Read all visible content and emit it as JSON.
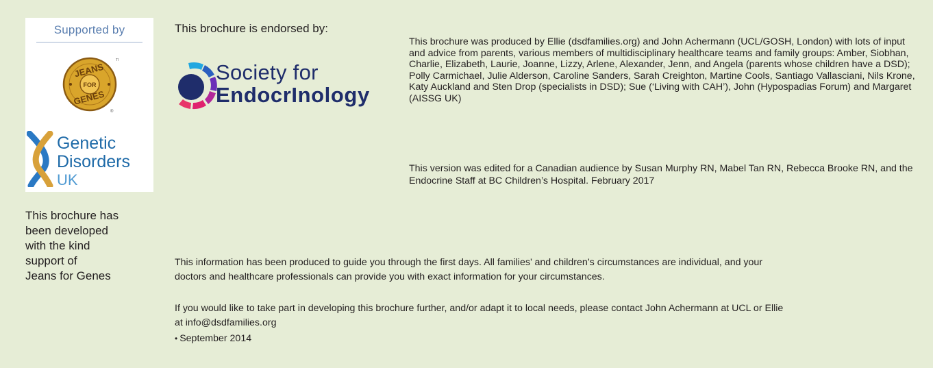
{
  "support_panel": {
    "supported_by": "Supported by",
    "jeans_for_genes_logo": {
      "top_text": "JEANS",
      "middle_text": "FOR",
      "bottom_text": "GENES",
      "tm": "TM",
      "registered": "®",
      "gold": "#d9a52b",
      "dark_gold": "#8a5a12"
    },
    "genetic_disorders_logo": {
      "line1": "Genetic",
      "line2": "Disorders",
      "line3": "UK",
      "text_color": "#1e6aa8",
      "uk_color": "#4f9ad2",
      "ribbon_blue": "#2a79c4",
      "ribbon_gold": "#d8a13a"
    }
  },
  "development_note": {
    "lines": [
      "This brochure has",
      "been developed",
      "with the kind",
      "support of",
      "Jeans for Genes"
    ]
  },
  "endorsement": {
    "heading": "This brochure is endorsed by:",
    "society_logo": {
      "line1": "Society for",
      "line2": "EndocrInology",
      "navy": "#1f2d6b",
      "ring_colors": [
        "#21a7e0",
        "#2a5fbf",
        "#6b2fb8",
        "#b3279a",
        "#e0216e",
        "#e8356a"
      ]
    }
  },
  "credits": {
    "text": "This brochure was produced by Ellie (dsdfamilies.org) and John Achermann (UCL/GOSH, London) with lots of input and advice from parents, various members of multidisciplinary healthcare teams and family groups: Amber, Siobhan, Charlie, Elizabeth, Laurie, Joanne, Lizzy, Arlene, Alexander, Jenn, and Angela (parents whose children have a DSD); Polly Carmichael, Julie Alderson, Caroline Sanders, Sarah Creighton, Martine Cools, Santiago Vallasciani, Nils Krone, Katy Auckland and Sten Drop (specialists in DSD); Sue (‘Living with CAH’), John (Hypospadias Forum) and Margaret (AISSG UK)",
    "version_note": "This version was edited for a Canadian audience by Susan Murphy RN, Mabel Tan RN, Rebecca Brooke RN, and the Endocrine Staff at BC Children’s Hospital. February 2017"
  },
  "info": {
    "guidance": "This information has been produced to guide you through the first days. All families’ and children’s circumstances are individual, and your doctors and healthcare professionals can provide you with exact information for your circumstances.",
    "contact": "If you would like to take part in developing this brochure further, and/or adapt it to local needs, please contact John Achermann at UCL or Ellie at info@dsdfamilies.org",
    "date_bullet": "•",
    "date": "September 2014"
  },
  "colors": {
    "page_background": "#e6edd6",
    "panel_background": "#ffffff",
    "body_text": "#231f20",
    "supported_by_text": "#5b7fb0"
  }
}
